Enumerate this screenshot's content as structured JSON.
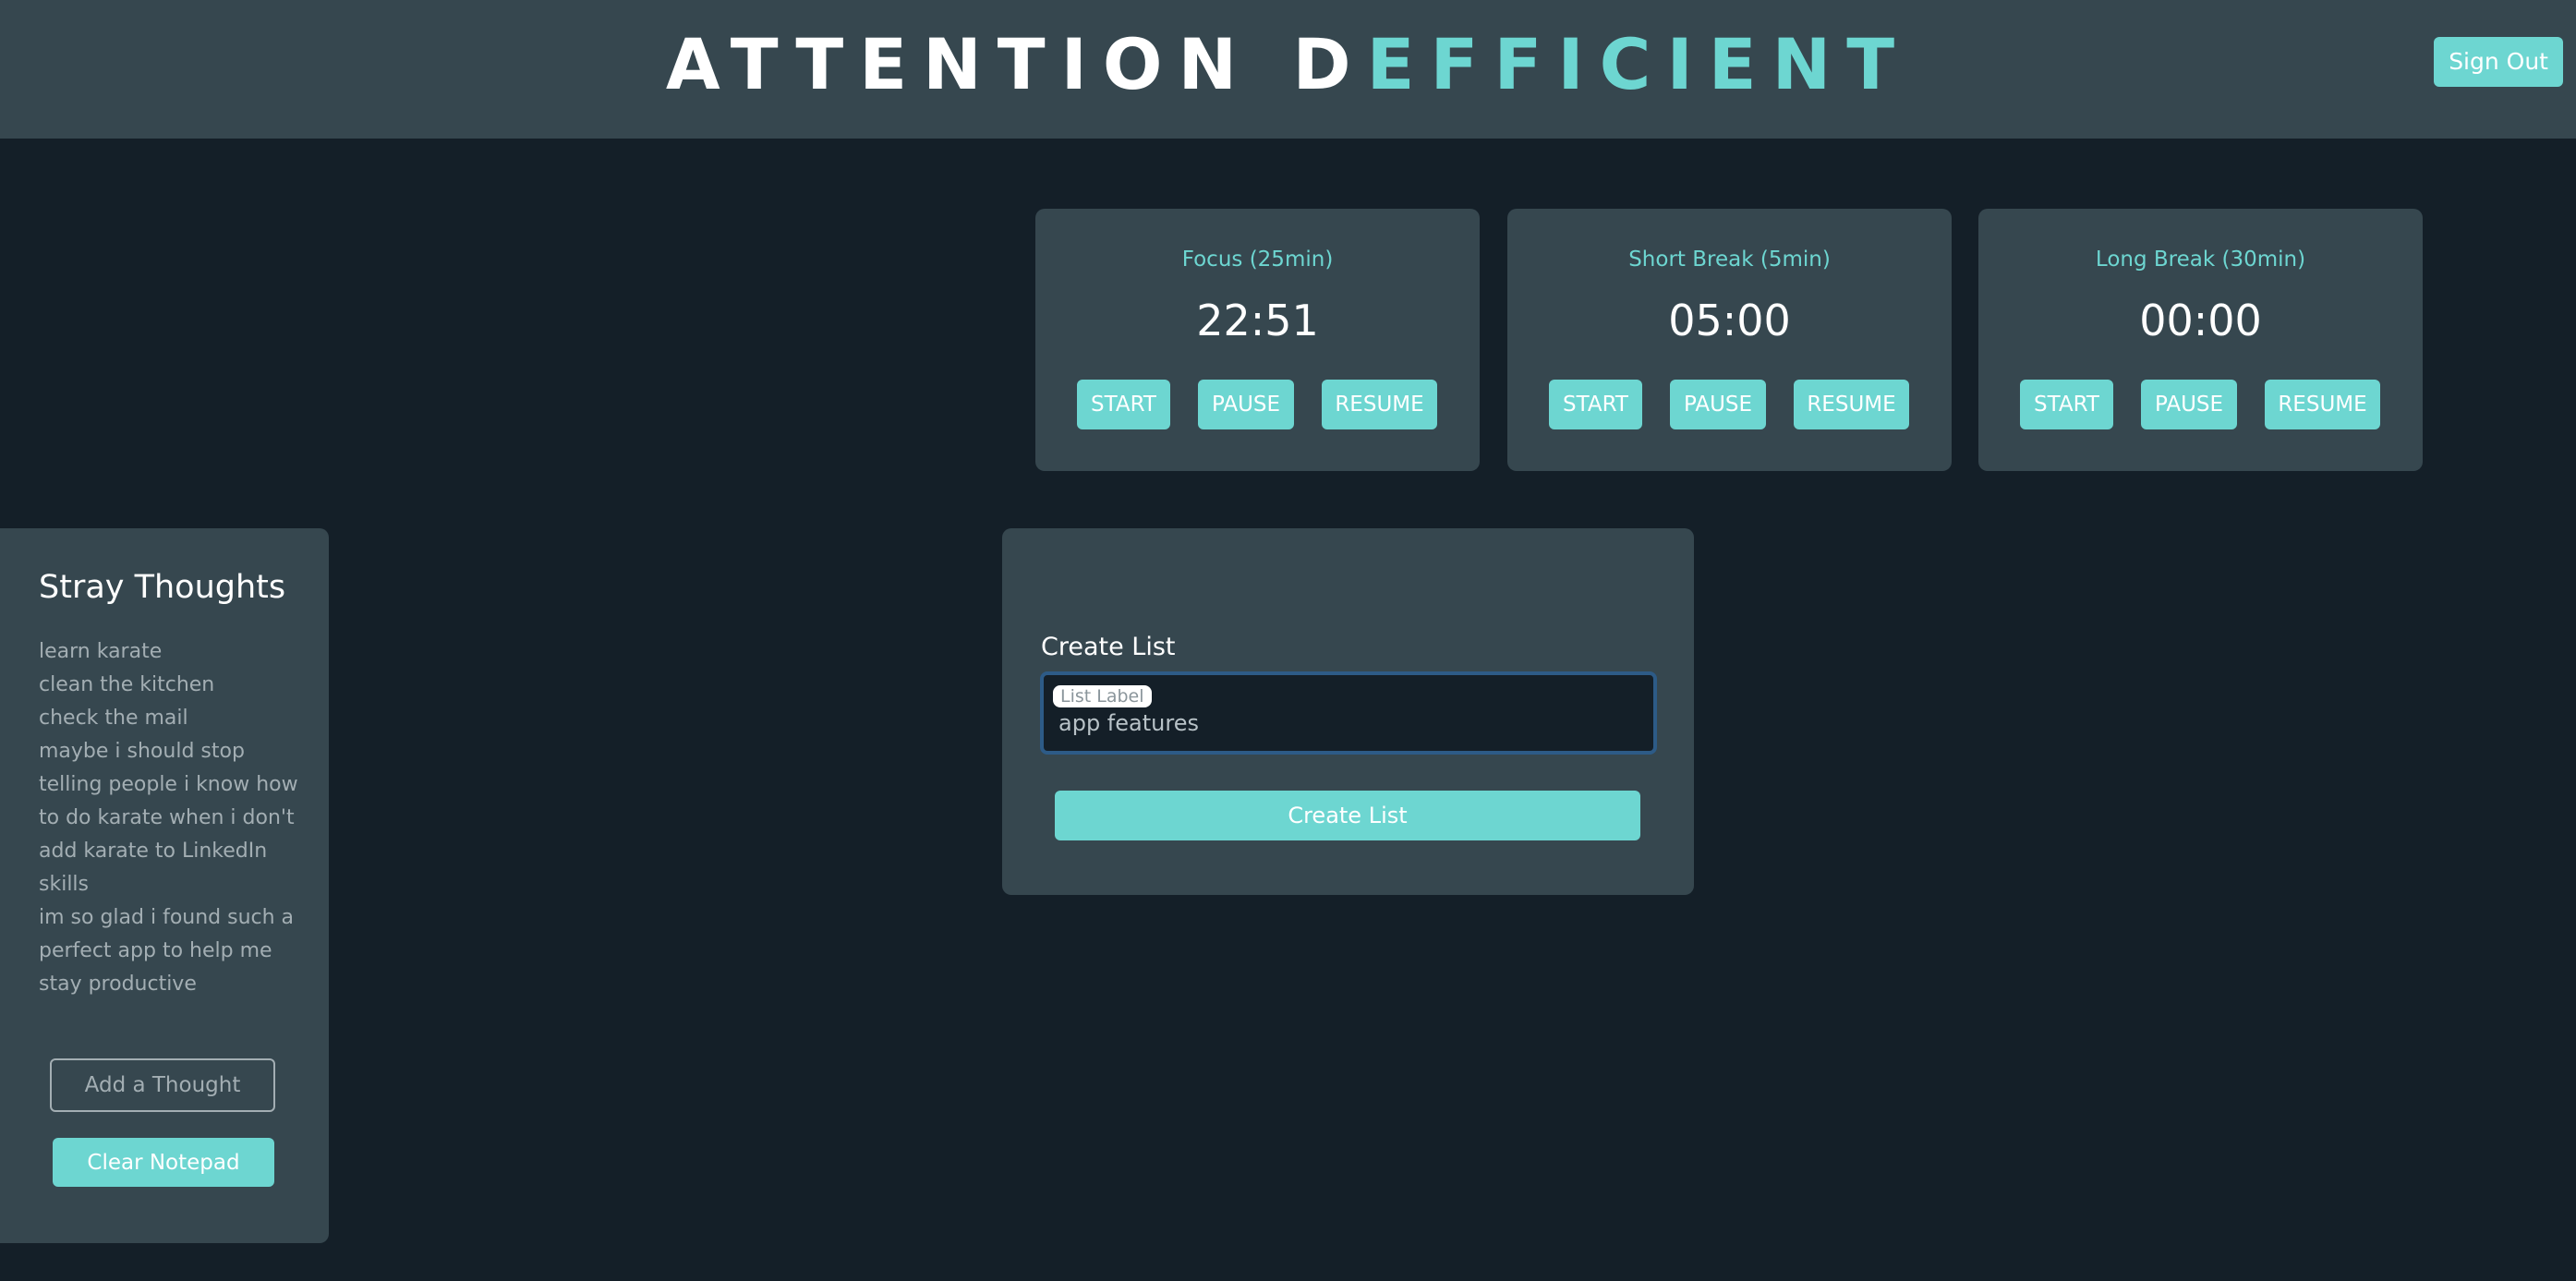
{
  "header": {
    "title_part1": "ATTENTION D",
    "title_part2": "EFFICIENT",
    "sign_out_label": "Sign Out"
  },
  "timers": [
    {
      "label": "Focus (25min)",
      "time": "22:51",
      "start": "START",
      "pause": "PAUSE",
      "resume": "RESUME"
    },
    {
      "label": "Short Break (5min)",
      "time": "05:00",
      "start": "START",
      "pause": "PAUSE",
      "resume": "RESUME"
    },
    {
      "label": "Long Break (30min)",
      "time": "00:00",
      "start": "START",
      "pause": "PAUSE",
      "resume": "RESUME"
    }
  ],
  "notepad": {
    "heading": "Stray Thoughts",
    "thoughts": [
      "learn karate",
      "clean the kitchen",
      "check the mail",
      "maybe i should stop telling people i know how to do karate when i don't",
      "add karate to LinkedIn skills",
      "im so glad i found such a perfect app to help me stay productive"
    ],
    "add_label": "Add a Thought",
    "clear_label": "Clear Notepad"
  },
  "create_list": {
    "heading": "Create List",
    "field_label": "List Label",
    "field_value": "app features",
    "button_label": "Create List"
  },
  "colors": {
    "accent": "#6dd6d1",
    "background": "#141f28",
    "card": "#36474f",
    "focus_border": "#2d5b87"
  }
}
